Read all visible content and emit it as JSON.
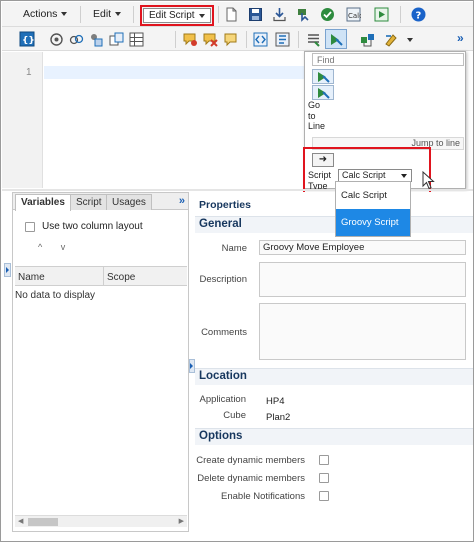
{
  "toolbar": {
    "actions_label": "Actions",
    "edit_label": "Edit",
    "edit_script_label": "Edit Script",
    "help_label": "?"
  },
  "editor": {
    "line_number": "1"
  },
  "side_panel": {
    "find_placeholder": "Find",
    "go_to_line_label": "Go to Line",
    "go_lines": [
      "Go",
      "to",
      "Line"
    ],
    "jump_to_line_label": "Jump to line",
    "arrow_label": "➜",
    "script_type_lines": [
      "Script",
      "Type"
    ],
    "script_type_selected": "Calc Script",
    "script_type_options": [
      "Calc Script",
      "Groovy Script"
    ],
    "highlighted_option": "Groovy Script"
  },
  "left_panel": {
    "tabs": [
      "Variables",
      "Script",
      "Usages"
    ],
    "active_tab": "Variables",
    "more_label": "»",
    "two_column_label": "Use two column layout",
    "move_up": "^",
    "move_down": "v",
    "columns": [
      "Name",
      "Scope"
    ],
    "empty_text": "No data to display"
  },
  "properties": {
    "title": "Properties",
    "general_header": "General",
    "name_label": "Name",
    "name_value": "Groovy Move Employee",
    "description_label": "Description",
    "comments_label": "Comments",
    "location_header": "Location",
    "application_label": "Application",
    "application_value": "HP4",
    "cube_label": "Cube",
    "cube_value": "Plan2",
    "options_header": "Options",
    "create_dynamic_label": "Create dynamic members",
    "delete_dynamic_label": "Delete dynamic members",
    "enable_notifications_label": "Enable Notifications"
  },
  "colors": {
    "highlight_red": "#e0141e",
    "selection_blue": "#1e88e5",
    "header_navy": "#17375e",
    "link_blue": "#1a5fb4"
  },
  "icons": {
    "toolbar_row1": [
      "new-document-icon",
      "save-icon",
      "download-icon",
      "validate-icon",
      "execute-check-icon",
      "calc-icon",
      "run-icon",
      "help-icon"
    ],
    "toolbar_row2": [
      "member-selector-icon",
      "function-icon",
      "link-icon",
      "copy-icon",
      "grid-icon",
      "comment-icon",
      "delete-comment-icon",
      "note-icon",
      "code-icon",
      "format-icon",
      "list-icon",
      "active-go-to-line-icon",
      "template-icon",
      "paint-icon",
      "more-icon"
    ]
  }
}
